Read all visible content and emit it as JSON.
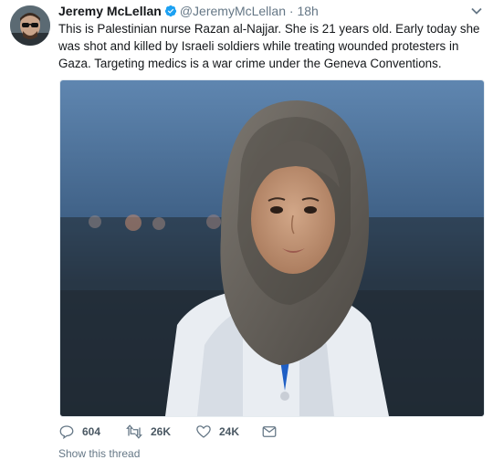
{
  "tweet": {
    "author_name": "Jeremy McLellan",
    "author_handle": "@JeremyMcLellan",
    "separator": "·",
    "time_ago": "18h",
    "text": "This is Palestinian nurse Razan al-Najjar. She is 21 years old. Early today she was shot and killed by Israeli soldiers while treating wounded protesters in Gaza. Targeting medics is a war crime under the Geneva Conventions.",
    "media_icon": "photo",
    "actions": {
      "replies": "604",
      "retweets": "26K",
      "likes": "24K"
    },
    "footer_partial": "Show this thread"
  },
  "colors": {
    "verified": "#1da1f2",
    "meta_gray": "#657786",
    "text": "#14171a"
  },
  "icons": [
    "verified-badge-icon",
    "chevron-down-icon",
    "reply-icon",
    "retweet-icon",
    "like-icon",
    "direct-message-icon"
  ]
}
